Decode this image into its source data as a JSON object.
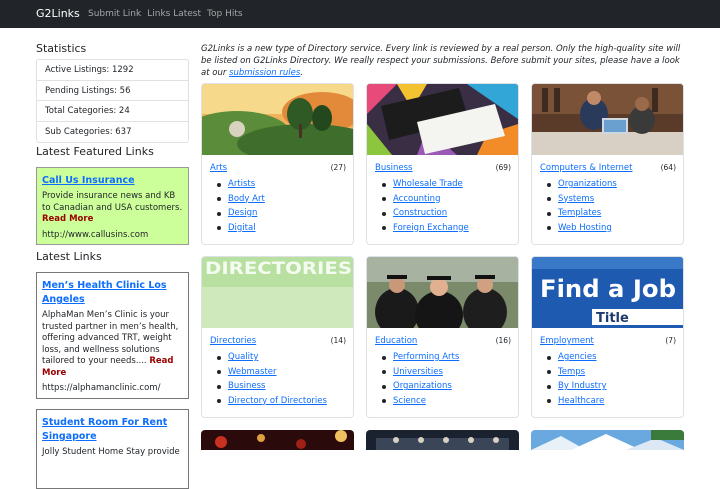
{
  "navbar": {
    "brand": "G2Links",
    "links": [
      "Submit Link",
      "Links Latest",
      "Top Hits"
    ]
  },
  "sidebar": {
    "stats_heading": "Statistics",
    "stats": [
      "Active Listings: 1292",
      "Pending Listings: 56",
      "Total Categories: 24",
      "Sub Categories: 637"
    ],
    "featured_heading": "Latest Featured Links",
    "featured": {
      "title": "Call Us Insurance",
      "body": "Provide insurance news and KB to Canadian and USA customers.",
      "read_more": "Read More",
      "url": "http://www.callusins.com"
    },
    "latest_heading": "Latest Links",
    "latest": [
      {
        "title": "Men’s Health Clinic Los Angeles",
        "body": "AlphaMan Men’s Clinic is your trusted partner in men’s health, offering advanced TRT, weight loss, and wellness solutions tailored to your needs....",
        "read_more": "Read More",
        "url": "https://alphamanclinic.com/"
      },
      {
        "title": "Student Room For Rent Singapore",
        "body": "Jolly Student Home Stay provide"
      }
    ]
  },
  "intro": {
    "text": "G2Links is a new type of Directory service. Every link is reviewed by a real person. Only the high-quality site will be listed on G2Links Directory. We really respect your submissions. Before submit your sites, please have a look at our",
    "link": "submission rules",
    "end": "."
  },
  "categories": [
    {
      "name": "Arts",
      "count": "(27)",
      "subs": [
        "Artists",
        "Body Art",
        "Design",
        "Digital"
      ],
      "image": "arts-painting"
    },
    {
      "name": "Business",
      "count": "(69)",
      "subs": [
        "Wholesale Trade",
        "Accounting",
        "Construction",
        "Foreign Exchange"
      ],
      "image": "business-card"
    },
    {
      "name": "Computers & Internet",
      "count": "(64)",
      "subs": [
        "Organizations",
        "Systems",
        "Templates",
        "Web Hosting"
      ],
      "image": "computers-people"
    },
    {
      "name": "Directories",
      "count": "(14)",
      "subs": [
        "Quality",
        "Webmaster",
        "Business",
        "Directory of Directories"
      ],
      "image": "directories-text",
      "image_text": "DIRECTORIES"
    },
    {
      "name": "Education",
      "count": "(16)",
      "subs": [
        "Performing Arts",
        "Universities",
        "Organizations",
        "Science"
      ],
      "image": "education-graduates"
    },
    {
      "name": "Employment",
      "count": "(7)",
      "subs": [
        "Agencies",
        "Temps",
        "By Industry",
        "Healthcare"
      ],
      "image": "find-a-job",
      "image_text": "Find a Job",
      "image_subtext": "Title"
    }
  ],
  "colors": {
    "navbar": "#212529",
    "link": "#0d6efd",
    "featured_bg": "#ccff99",
    "read_more": "#990000"
  }
}
